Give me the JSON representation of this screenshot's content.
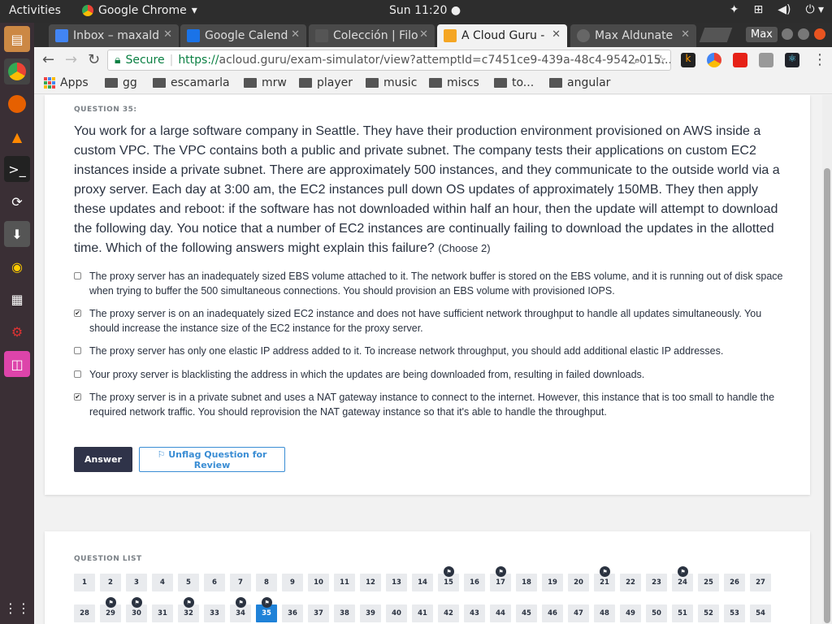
{
  "os": {
    "activities": "Activities",
    "app_name": "Google Chrome",
    "clock": "Sun 11:20"
  },
  "tabs": [
    {
      "label": "Inbox – maxald",
      "favicon_color": "#4285f4"
    },
    {
      "label": "Google Calend",
      "favicon_color": "#1a73e8"
    },
    {
      "label": "Colección | Filo",
      "favicon_color": "#555555"
    },
    {
      "label": "A Cloud Guru -",
      "favicon_color": "#f5a623"
    },
    {
      "label": "Max Aldunate",
      "favicon_color": "#666666"
    }
  ],
  "profile": "Max",
  "toolbar": {
    "secure_label": "Secure",
    "url_proto": "https://",
    "url_rest": "acloud.guru/exam-simulator/view?attemptId=c7451ce9-439a-48c4-9542-015..."
  },
  "bookmarks": {
    "apps": "Apps",
    "folders": [
      "gg",
      "escamarla",
      "mrw",
      "player",
      "music",
      "miscs",
      "to...",
      "angular"
    ]
  },
  "question": {
    "label": "QUESTION 35:",
    "text": "You work for a large software company in Seattle. They have their production environment provisioned on AWS inside a custom VPC. The VPC contains both a public and private subnet. The company tests their applications on custom EC2 instances inside a private subnet. There are approximately 500 instances, and they communicate to the outside world via a proxy server. Each day at 3:00 am, the EC2 instances pull down OS updates of approximately 150MB. They then apply these updates and reboot: if the software has not downloaded within half an hour, then the update will attempt to download the following day. You notice that a number of EC2 instances are continually failing to download the updates in the allotted time. Which of the following answers might explain this failure?",
    "choose": "(Choose 2)",
    "options": [
      {
        "text": "The proxy server has an inadequately sized EBS volume attached to it. The network buffer is stored on the EBS volume, and it is running out of disk space when trying to buffer the 500 simultaneous connections. You should provision an EBS volume with provisioned IOPS.",
        "checked": false
      },
      {
        "text": "The proxy server is on an inadequately sized EC2 instance and does not have sufficient network throughput to handle all updates simultaneously. You should increase the instance size of the EC2 instance for the proxy server.",
        "checked": true
      },
      {
        "text": "The proxy server has only one elastic IP address added to it. To increase network throughput, you should add additional elastic IP addresses.",
        "checked": false
      },
      {
        "text": "Your proxy server is blacklisting the address in which the updates are being downloaded from, resulting in failed downloads.",
        "checked": false
      },
      {
        "text": "The proxy server is in a private subnet and uses a NAT gateway instance to connect to the internet. However, this instance that is too small to handle the required network traffic. You should reprovision the NAT gateway instance so that it's able to handle the throughput.",
        "checked": true
      }
    ],
    "answer_label": "Answer",
    "flag_label": "Unflag Question for Review"
  },
  "question_list": {
    "label": "QUESTION LIST",
    "current": 35,
    "flagged": [
      15,
      17,
      21,
      24,
      29,
      30,
      32,
      34,
      35
    ],
    "row1": [
      1,
      2,
      3,
      4,
      5,
      6,
      7,
      8,
      9,
      10,
      11,
      12,
      13,
      14,
      15,
      16,
      17,
      18,
      19,
      20,
      21,
      22,
      23,
      24,
      25,
      26,
      27
    ],
    "row2": [
      28,
      29,
      30,
      31,
      32,
      33,
      34,
      35,
      36,
      37,
      38,
      39,
      40,
      41,
      42,
      43,
      44,
      45,
      46,
      47,
      48,
      49,
      50,
      51,
      52,
      53,
      54
    ]
  }
}
